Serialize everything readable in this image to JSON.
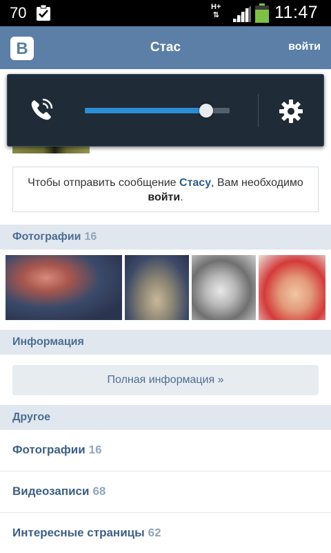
{
  "status_bar": {
    "notification_count": "70",
    "network_type": "H+",
    "network_arrows": "⇅",
    "time": "11:47",
    "icons": [
      "clipboard-check-icon",
      "signal-icon",
      "battery-icon"
    ]
  },
  "header": {
    "logo_text": "B",
    "title": "Стас",
    "login_label": "войти"
  },
  "volume_overlay": {
    "stream": "in-call",
    "level": 0.84,
    "icons": [
      "phone-call-icon",
      "gear-icon"
    ],
    "colors": {
      "background": "#1f2b37",
      "fill": "#2b8ed4"
    }
  },
  "message_box": {
    "text_before": "Чтобы отправить сообщение ",
    "recipient": "Стасу",
    "text_middle": ", Вам необходимо ",
    "login_link": "войти",
    "text_after": "."
  },
  "photos_section": {
    "title": "Фотографии",
    "count": "16"
  },
  "info_section": {
    "title": "Информация",
    "button_label": "Полная информация »"
  },
  "other_section": {
    "title": "Другое",
    "items": [
      {
        "label": "Фотографии",
        "count": "16"
      },
      {
        "label": "Видеозаписи",
        "count": "68"
      },
      {
        "label": "Интересные страницы",
        "count": "62"
      }
    ]
  },
  "colors": {
    "header": "#5b7fa6",
    "section_bg": "#e0e7ef",
    "link": "#2d5b8a",
    "count": "#92a5ba"
  }
}
